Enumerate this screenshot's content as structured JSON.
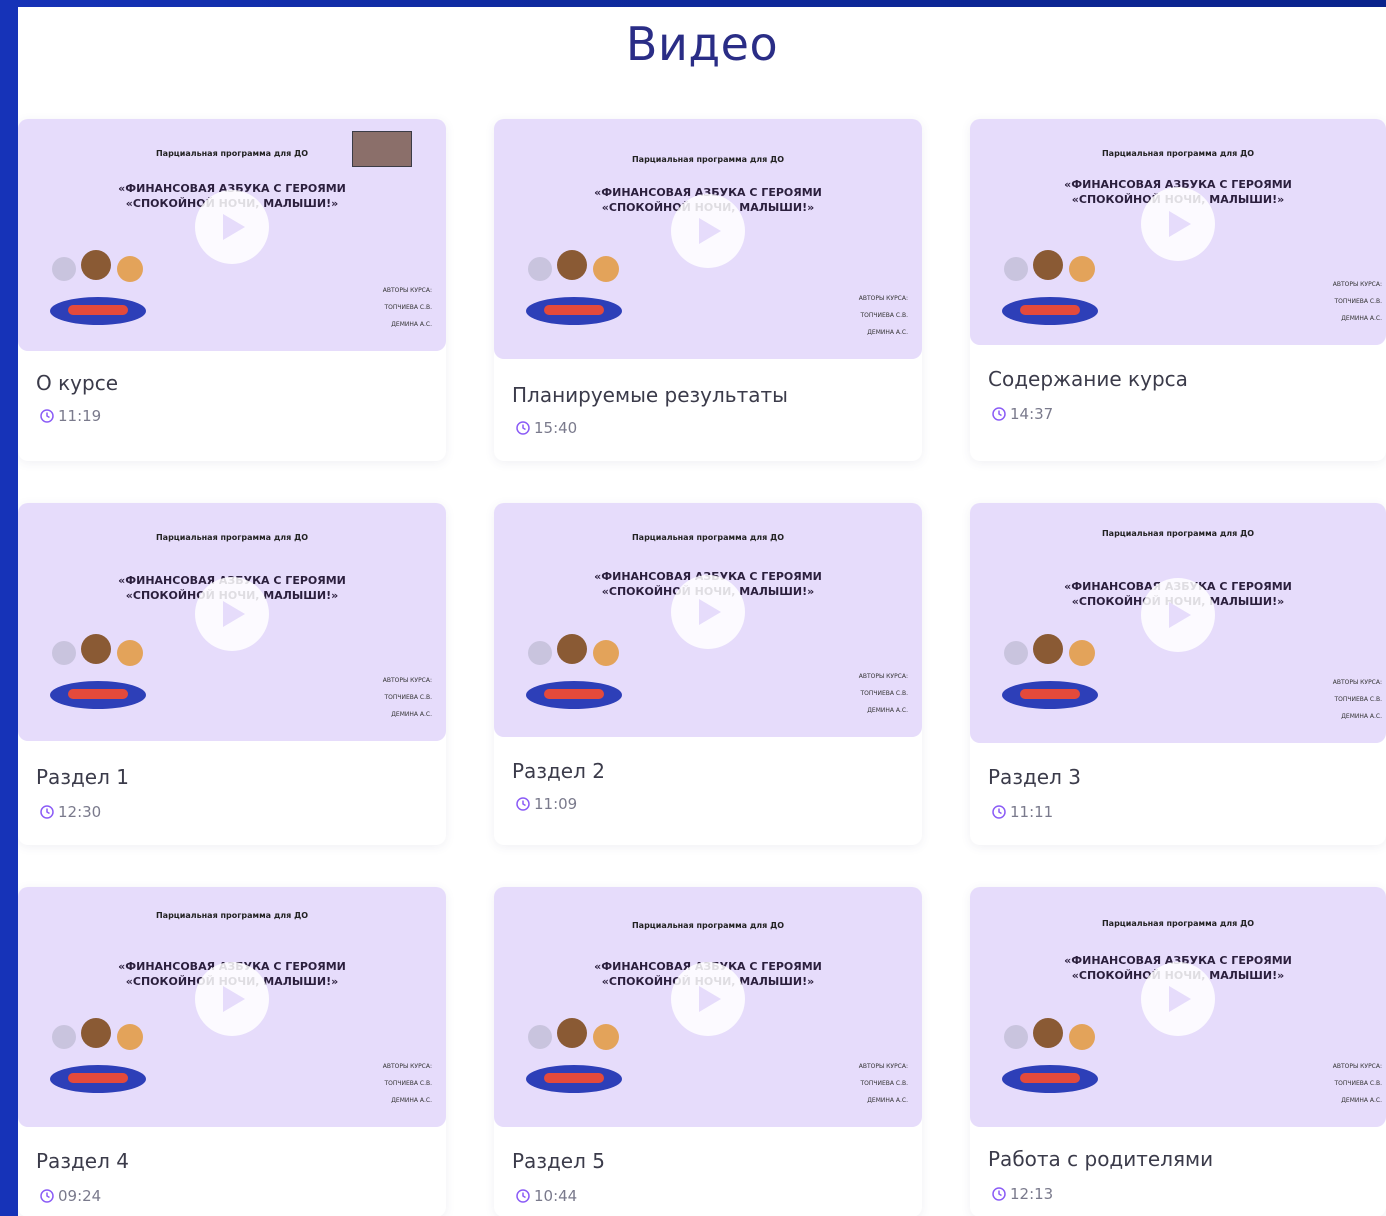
{
  "page_title": "Видео",
  "colors": {
    "accent": "#8b5cf6",
    "thumb_bg": "#e6dcfb",
    "title": "#2a2d86"
  },
  "thumbnail_text": {
    "program": "Парциальная программа для ДО",
    "headline_line1": "«ФИНАНСОВАЯ АЗБУКА С ГЕРОЯМИ",
    "headline_line2": "«СПОКОЙНОЙ НОЧИ, МАЛЫШИ!»",
    "authors": [
      "АВТОРЫ КУРСА:",
      "ТОПЧИЕВА С.В.",
      "ДЕМИНА А.С."
    ]
  },
  "videos": [
    {
      "title": "О курсе",
      "duration": "11:19"
    },
    {
      "title": "Планируемые результаты",
      "duration": "15:40"
    },
    {
      "title": "Содержание курса",
      "duration": "14:37"
    },
    {
      "title": "Раздел 1",
      "duration": "12:30"
    },
    {
      "title": "Раздел 2",
      "duration": "11:09"
    },
    {
      "title": "Раздел 3",
      "duration": "11:11"
    },
    {
      "title": "Раздел 4",
      "duration": "09:24"
    },
    {
      "title": "Раздел 5",
      "duration": "10:44"
    },
    {
      "title": "Работа с родителями",
      "duration": "12:13"
    }
  ]
}
